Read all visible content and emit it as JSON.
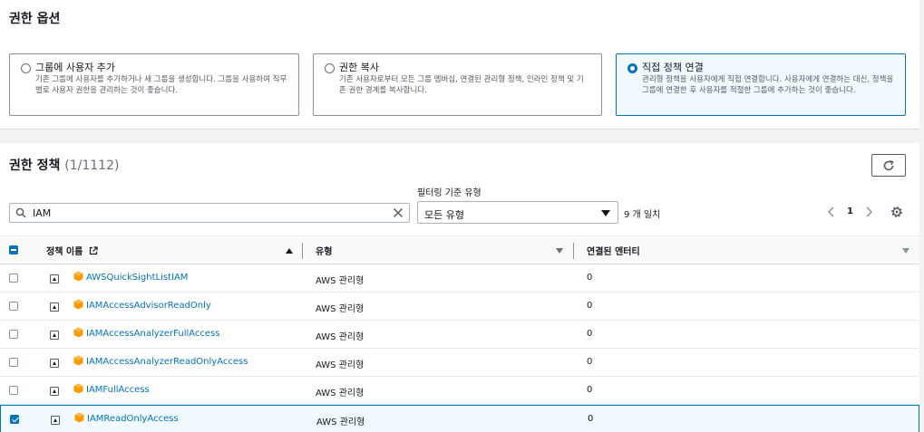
{
  "permission_options": {
    "title": "권한 옵션",
    "options": [
      {
        "label": "그룹에 사용자 추가",
        "description": "기존 그룹에 사용자를 추가하거나 새 그룹을 생성합니다. 그룹을 사용하여 직무별로 사용자 권한을 관리하는 것이 좋습니다.",
        "selected": false
      },
      {
        "label": "권한 복사",
        "description": "기존 사용자로부터 모든 그룹 멤버십, 연결된 관리형 정책, 인라인 정책 및 기존 권한 경계를 복사합니다.",
        "selected": false
      },
      {
        "label": "직접 정책 연결",
        "description": "관리형 정책을 사용자에게 직접 연결합니다. 사용자에게 연결하는 대신, 정책을 그룹에 연결한 후 사용자를 적절한 그룹에 추가하는 것이 좋습니다.",
        "selected": true
      }
    ]
  },
  "policies": {
    "title": "권한 정책",
    "count": "(1/1112)",
    "refresh_icon": "refresh-icon",
    "search": {
      "value": "IAM",
      "icon": "search-icon",
      "clear_icon": "close-icon"
    },
    "filter": {
      "label": "필터링 기준 유형",
      "selected": "모든 유형"
    },
    "match_count": "9 개 일치",
    "pagination": {
      "current_page": "1"
    },
    "columns": {
      "name": "정책 이름",
      "type": "유형",
      "entities": "연결된 엔터티"
    },
    "rows": [
      {
        "name": "AWSQuickSightListIAM",
        "type": "AWS 관리형",
        "entities": "0",
        "checked": false
      },
      {
        "name": "IAMAccessAdvisorReadOnly",
        "type": "AWS 관리형",
        "entities": "0",
        "checked": false
      },
      {
        "name": "IAMAccessAnalyzerFullAccess",
        "type": "AWS 관리형",
        "entities": "0",
        "checked": false
      },
      {
        "name": "IAMAccessAnalyzerReadOnlyAccess",
        "type": "AWS 관리형",
        "entities": "0",
        "checked": false
      },
      {
        "name": "IAMFullAccess",
        "type": "AWS 관리형",
        "entities": "0",
        "checked": false
      },
      {
        "name": "IAMReadOnlyAccess",
        "type": "AWS 관리형",
        "entities": "0",
        "checked": true
      }
    ]
  },
  "colors": {
    "accent": "#0073bb",
    "policy_icon": "#ff9900"
  }
}
